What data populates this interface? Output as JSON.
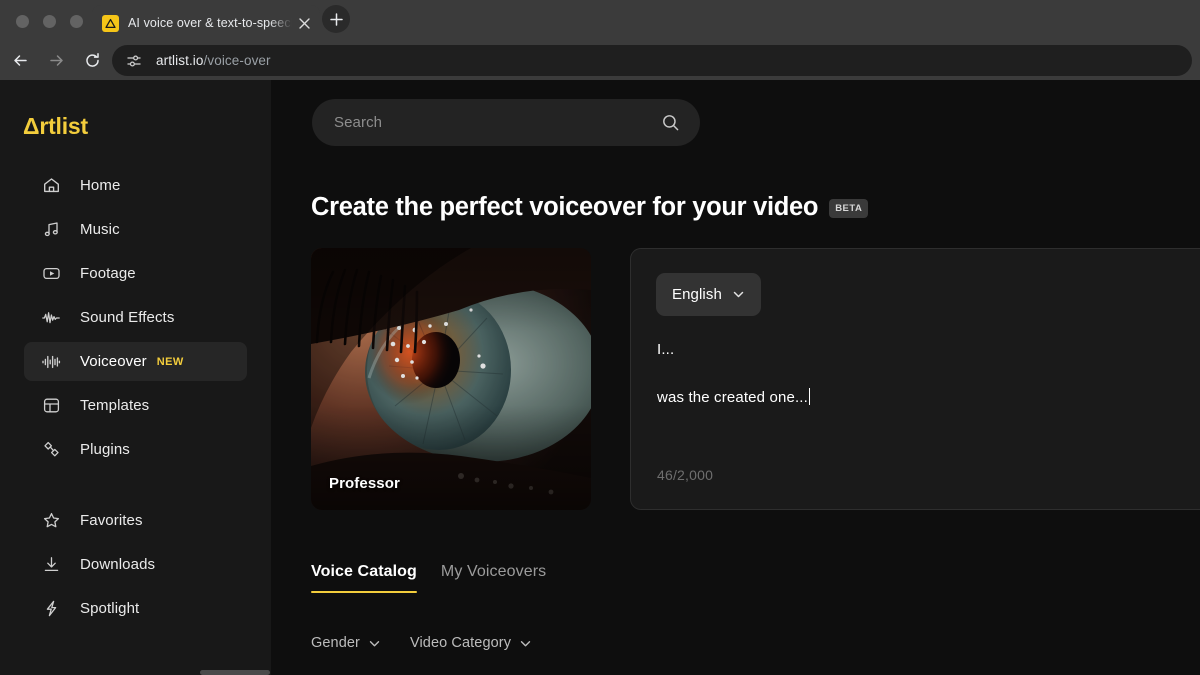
{
  "browser": {
    "tab": {
      "title": "AI voice over & text-to-speech",
      "favicon_icon": "artlist-triangle-icon",
      "close_icon": "close-icon"
    },
    "new_tab_label": "+",
    "back_icon": "arrow-left-icon",
    "forward_icon": "arrow-right-icon",
    "reload_icon": "reload-icon",
    "site_settings_icon": "page-settings-icon",
    "url_domain": "artlist.io",
    "url_path": "/voice-over"
  },
  "sidebar": {
    "logo": "Artlist",
    "logo_triangle": "Δ",
    "logo_rest": "rtlist",
    "items": [
      {
        "label": "Home",
        "icon": "home-icon",
        "active": false
      },
      {
        "label": "Music",
        "icon": "music-note-icon",
        "active": false
      },
      {
        "label": "Footage",
        "icon": "video-play-icon",
        "active": false
      },
      {
        "label": "Sound Effects",
        "icon": "waveform-icon",
        "active": false
      },
      {
        "label": "Voiceover",
        "icon": "voice-bars-icon",
        "active": true,
        "badge": "NEW"
      },
      {
        "label": "Templates",
        "icon": "layout-icon",
        "active": false
      },
      {
        "label": "Plugins",
        "icon": "plugins-icon",
        "active": false
      }
    ],
    "items_secondary": [
      {
        "label": "Favorites",
        "icon": "star-icon"
      },
      {
        "label": "Downloads",
        "icon": "download-icon"
      },
      {
        "label": "Spotlight",
        "icon": "lightning-icon"
      }
    ]
  },
  "search": {
    "placeholder": "Search",
    "icon": "search-icon"
  },
  "header": {
    "title": "Create the perfect voiceover for your video",
    "badge": "BETA"
  },
  "voice_card": {
    "name": "Professor"
  },
  "editor": {
    "language": "English",
    "language_chevron_icon": "chevron-down-icon",
    "line1": "I...",
    "line2": "was the created one...",
    "counter": "46/2,000"
  },
  "tabs": [
    {
      "label": "Voice Catalog",
      "active": true
    },
    {
      "label": "My Voiceovers",
      "active": false
    }
  ],
  "filters": [
    {
      "label": "Gender",
      "icon": "chevron-down-icon"
    },
    {
      "label": "Video Category",
      "icon": "chevron-down-icon"
    }
  ],
  "colors": {
    "brand_yellow": "#f3cd3c",
    "page_bg": "#0e0e0e",
    "sidebar_bg": "#181818",
    "panel_bg": "#1a1a1a",
    "chrome_bg": "#3b3b3b"
  }
}
